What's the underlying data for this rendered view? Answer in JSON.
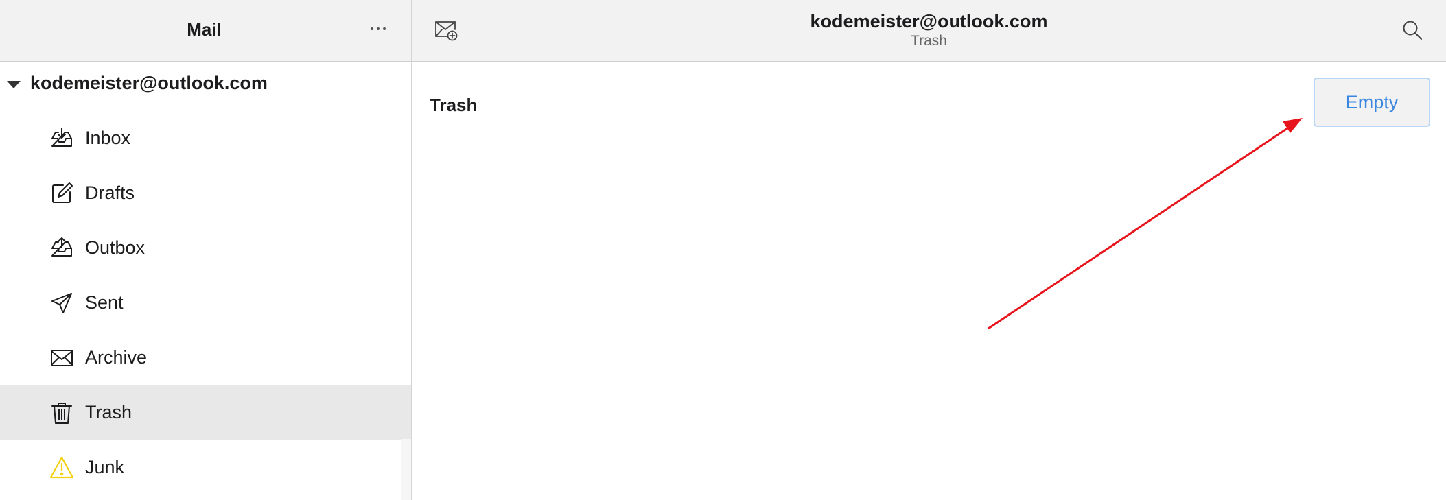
{
  "sidebar": {
    "title": "Mail",
    "account": "kodemeister@outlook.com",
    "folders": [
      {
        "label": "Inbox",
        "icon": "inbox-icon"
      },
      {
        "label": "Drafts",
        "icon": "drafts-icon"
      },
      {
        "label": "Outbox",
        "icon": "outbox-icon"
      },
      {
        "label": "Sent",
        "icon": "sent-icon"
      },
      {
        "label": "Archive",
        "icon": "archive-icon"
      },
      {
        "label": "Trash",
        "icon": "trash-icon",
        "selected": true
      },
      {
        "label": "Junk",
        "icon": "junk-warning-icon"
      }
    ]
  },
  "header": {
    "account": "kodemeister@outlook.com",
    "folder": "Trash"
  },
  "main": {
    "title": "Trash",
    "empty_label": "Empty"
  },
  "colors": {
    "accent": "#3a87e0",
    "selected_row": "#e8e8e8",
    "header_bg": "#f2f2f2",
    "annotation_arrow": "#e8141b",
    "junk_icon": "#f2d013"
  }
}
